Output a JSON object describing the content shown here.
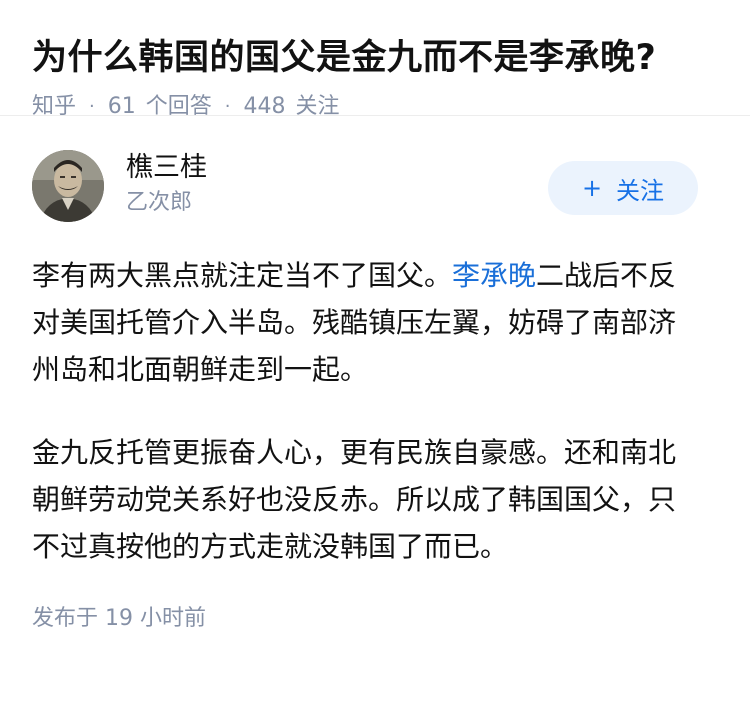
{
  "question": {
    "title": "为什么韩国的国父是金九而不是李承晚?",
    "source": "知乎",
    "answer_count": "61",
    "answer_label": "个回答",
    "follower_count": "448",
    "follower_label": "关注"
  },
  "answer": {
    "author_name": "樵三桂",
    "author_subtitle": "乙次郎",
    "follow_button": {
      "icon": "+",
      "label": "关注"
    },
    "paragraph1": {
      "part1": "李有两大黑点就注定当不了国父。",
      "link": "李承晚",
      "part2": "二战后不反对美国托管介入半岛。残酷镇压左翼，妨碍了南部济州岛和北面朝鲜走到一起。"
    },
    "paragraph2": "金九反托管更振奋人心，更有民族自豪感。还和南北朝鲜劳动党关系好也没反赤。所以成了韩国国父，只不过真按他的方式走就没韩国了而已。",
    "published": {
      "label": "发布于",
      "value": "19 小时前"
    }
  },
  "colors": {
    "text": "#121212",
    "meta": "#8590a6",
    "link": "#1a6fd8",
    "button_bg": "#ebf3fd",
    "button_text": "#1771e6"
  }
}
